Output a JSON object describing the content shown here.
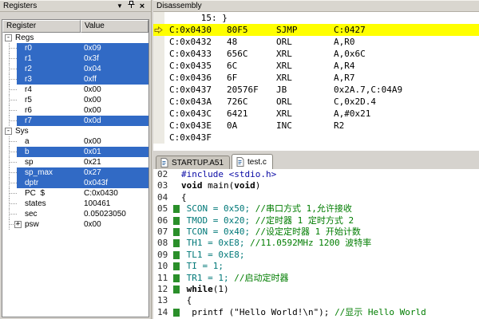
{
  "colors": {
    "selection_blue": "#316ac5",
    "current_line_yellow": "#ffff00",
    "coverage_green": "#2a8f2a",
    "comment_green": "#007d00",
    "code_teal": "#007878",
    "include_blue": "#0b0ba6",
    "panel_gray": "#d6d3ce"
  },
  "registers": {
    "title": "Registers",
    "buttons": {
      "dropdown": "▼",
      "close": "×"
    },
    "columns": [
      "Register",
      "Value"
    ],
    "rows": [
      {
        "name": "Regs",
        "type": "group",
        "expander": "minus",
        "value": ""
      },
      {
        "name": "r0",
        "type": "child",
        "value": "0x09",
        "highlight": true
      },
      {
        "name": "r1",
        "type": "child",
        "value": "0x3f",
        "highlight": true
      },
      {
        "name": "r2",
        "type": "child",
        "value": "0x04",
        "highlight": true
      },
      {
        "name": "r3",
        "type": "child",
        "value": "0xff",
        "highlight": true
      },
      {
        "name": "r4",
        "type": "child",
        "value": "0x00",
        "highlight": false
      },
      {
        "name": "r5",
        "type": "child",
        "value": "0x00",
        "highlight": false
      },
      {
        "name": "r6",
        "type": "child",
        "value": "0x00",
        "highlight": false
      },
      {
        "name": "r7",
        "type": "child",
        "value": "0x0d",
        "highlight": true
      },
      {
        "name": "Sys",
        "type": "group",
        "expander": "minus",
        "value": ""
      },
      {
        "name": "a",
        "type": "child",
        "value": "0x00",
        "highlight": false
      },
      {
        "name": "b",
        "type": "child",
        "value": "0x01",
        "highlight": true
      },
      {
        "name": "sp",
        "type": "child",
        "value": "0x21",
        "highlight": false
      },
      {
        "name": "sp_max",
        "type": "child",
        "value": "0x27",
        "highlight": true
      },
      {
        "name": "dptr",
        "type": "child",
        "value": "0x043f",
        "highlight": true
      },
      {
        "name": "PC  $",
        "type": "child",
        "value": "C:0x0430",
        "highlight": false
      },
      {
        "name": "states",
        "type": "child",
        "value": "100461",
        "highlight": false
      },
      {
        "name": "sec",
        "type": "child",
        "value": "0.05023050",
        "highlight": false
      },
      {
        "name": "psw",
        "type": "child",
        "expander": "plus",
        "value": "0x00",
        "highlight": false
      }
    ]
  },
  "disassembly": {
    "title": "Disassembly",
    "lines": [
      {
        "type": "source",
        "text": "      15: }"
      },
      {
        "type": "code",
        "address": "C:0x0430",
        "bytes": "80F5",
        "mnemonic": "SJMP",
        "operands": "C:0427",
        "current": true
      },
      {
        "type": "code",
        "address": "C:0x0432",
        "bytes": "48",
        "mnemonic": "ORL",
        "operands": "A,R0"
      },
      {
        "type": "code",
        "address": "C:0x0433",
        "bytes": "656C",
        "mnemonic": "XRL",
        "operands": "A,0x6C"
      },
      {
        "type": "code",
        "address": "C:0x0435",
        "bytes": "6C",
        "mnemonic": "XRL",
        "operands": "A,R4"
      },
      {
        "type": "code",
        "address": "C:0x0436",
        "bytes": "6F",
        "mnemonic": "XRL",
        "operands": "A,R7"
      },
      {
        "type": "code",
        "address": "C:0x0437",
        "bytes": "20576F",
        "mnemonic": "JB",
        "operands": "0x2A.7,C:04A9"
      },
      {
        "type": "code",
        "address": "C:0x043A",
        "bytes": "726C",
        "mnemonic": "ORL",
        "operands": "C,0x2D.4"
      },
      {
        "type": "code",
        "address": "C:0x043C",
        "bytes": "6421",
        "mnemonic": "XRL",
        "operands": "A,#0x21"
      },
      {
        "type": "code",
        "address": "C:0x043E",
        "bytes": "0A",
        "mnemonic": "INC",
        "operands": "R2"
      },
      {
        "type": "code",
        "address": "C:0x043F",
        "bytes": "",
        "mnemonic": "",
        "operands": ""
      }
    ]
  },
  "editor": {
    "tabs": [
      {
        "label": "STARTUP.A51",
        "active": false
      },
      {
        "label": "test.c",
        "active": true
      }
    ],
    "lines": [
      {
        "num": "02",
        "marker": false,
        "segments": [
          {
            "style": "include",
            "text": "#include <stdio.h>"
          }
        ]
      },
      {
        "num": "03",
        "marker": false,
        "segments": [
          {
            "style": "kw",
            "text": "void"
          },
          {
            "style": "plain",
            "text": " main("
          },
          {
            "style": "kw",
            "text": "void"
          },
          {
            "style": "plain",
            "text": ")"
          }
        ]
      },
      {
        "num": "04",
        "marker": false,
        "segments": [
          {
            "style": "plain",
            "text": "{"
          }
        ]
      },
      {
        "num": "05",
        "marker": true,
        "segments": [
          {
            "style": "sfr",
            "text": " SCON = 0x50; "
          },
          {
            "style": "comment",
            "text": "//串口方式 1,允许接收"
          }
        ]
      },
      {
        "num": "06",
        "marker": true,
        "segments": [
          {
            "style": "sfr",
            "text": " TMOD = 0x20; "
          },
          {
            "style": "comment",
            "text": "//定时器 1 定时方式 2"
          }
        ]
      },
      {
        "num": "07",
        "marker": true,
        "segments": [
          {
            "style": "sfr",
            "text": " TCON = 0x40; "
          },
          {
            "style": "comment",
            "text": "//设定定时器 1 开始计数"
          }
        ]
      },
      {
        "num": "08",
        "marker": true,
        "segments": [
          {
            "style": "sfr",
            "text": " TH1 = 0xE8; "
          },
          {
            "style": "comment",
            "text": "//11.0592MHz 1200 波特率"
          }
        ]
      },
      {
        "num": "09",
        "marker": true,
        "segments": [
          {
            "style": "sfr",
            "text": " TL1 = 0xE8;"
          }
        ]
      },
      {
        "num": "10",
        "marker": true,
        "segments": [
          {
            "style": "sfr",
            "text": " TI = 1;"
          }
        ]
      },
      {
        "num": "11",
        "marker": true,
        "segments": [
          {
            "style": "sfr",
            "text": " TR1 = 1; "
          },
          {
            "style": "comment",
            "text": "//启动定时器"
          }
        ]
      },
      {
        "num": "12",
        "marker": true,
        "segments": [
          {
            "style": "plain",
            "text": " "
          },
          {
            "style": "kw",
            "text": "while"
          },
          {
            "style": "plain",
            "text": "(1)"
          }
        ]
      },
      {
        "num": "13",
        "marker": false,
        "segments": [
          {
            "style": "plain",
            "text": " {"
          }
        ]
      },
      {
        "num": "14",
        "marker": true,
        "segments": [
          {
            "style": "plain",
            "text": "  printf (\"Hello World!\\n\"); "
          },
          {
            "style": "comment",
            "text": "//显示 Hello World"
          }
        ]
      }
    ]
  }
}
